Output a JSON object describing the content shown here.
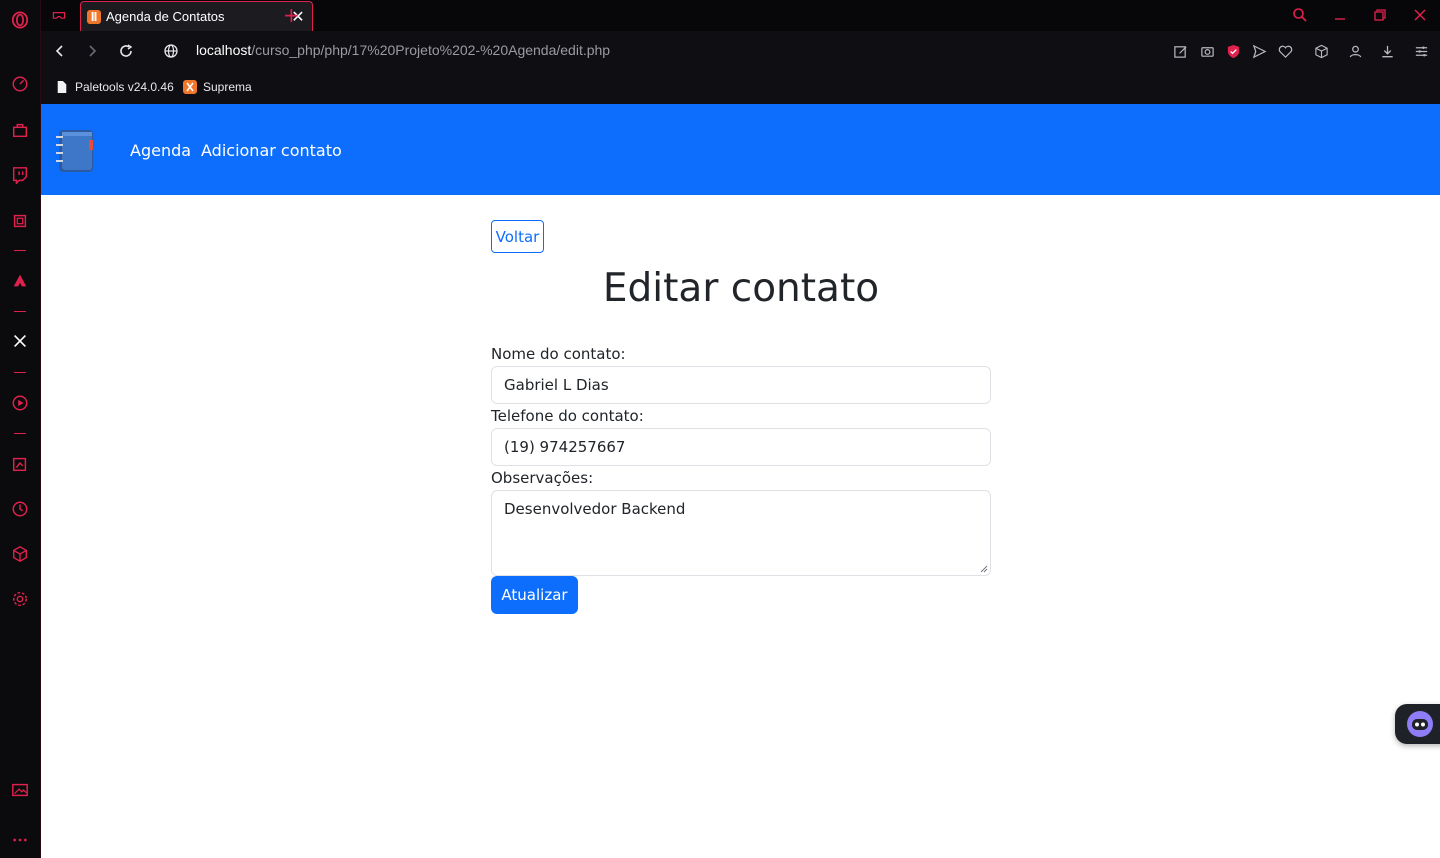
{
  "browser": {
    "tab_title": "Agenda de Contatos",
    "tab_close": "✕",
    "new_tab": "+",
    "url_host": "localhost",
    "url_path": "/curso_php/php/17%20Projeto%202-%20Agenda/edit.php",
    "bookmarks": [
      {
        "label": "Paletools v24.0.46",
        "icon": "page-icon"
      },
      {
        "label": "Suprema",
        "icon": "xampp-icon"
      }
    ],
    "accent_color": "#e0214d"
  },
  "site": {
    "nav": {
      "logo": "notebook-logo",
      "links": [
        "Agenda",
        "Adicionar contato"
      ]
    },
    "back_button": "Voltar",
    "title": "Editar contato",
    "form": {
      "name_label": "Nome do contato:",
      "name_value": "Gabriel L Dias",
      "phone_label": "Telefone do contato:",
      "phone_value": "(19) 974257667",
      "notes_label": "Observações:",
      "notes_value": "Desenvolvedor Backend",
      "submit": "Atualizar"
    },
    "primary_color": "#0d6efd"
  }
}
